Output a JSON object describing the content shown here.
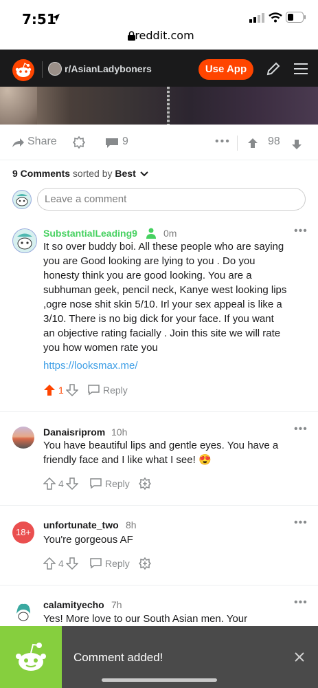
{
  "status_bar": {
    "time": "7:51",
    "url": "reddit.com"
  },
  "nav": {
    "subreddit": "r/AsianLadyboners",
    "use_app_label": "Use App"
  },
  "post_actions": {
    "share_label": "Share",
    "comment_count": "9",
    "score": "98"
  },
  "comments_header": {
    "count_label": "9 Comments",
    "sorted_by": "sorted by",
    "sort_value": "Best"
  },
  "comment_input": {
    "placeholder": "Leave a comment"
  },
  "comments": [
    {
      "username": "SubstantialLeading9",
      "time": "0m",
      "body_lines": [
        "It so over buddy boi. All these people who are saying",
        "you are Good looking are lying to you . Do you",
        "honesty think you are good looking. You are a",
        "subhuman geek, pencil neck, Kanye west looking lips",
        ",ogre nose shit skin 5/10. Irl your sex appeal is like a",
        "3/10. There is no big dick for your face. If you want",
        "an objective rating facially . Join this site we will rate",
        "you how women rate you"
      ],
      "link": "https://looksmax.me/",
      "votes": "1",
      "reply_label": "Reply"
    },
    {
      "username": "Danaisriprom",
      "time": "10h",
      "body_lines": [
        "You have beautiful lips and gentle eyes. You have a",
        "friendly face and I like what I see! 😍"
      ],
      "votes": "4",
      "reply_label": "Reply"
    },
    {
      "username": "unfortunate_two",
      "time": "8h",
      "avatar_text": "18+",
      "body_lines": [
        "You're gorgeous AF"
      ],
      "votes": "4",
      "reply_label": "Reply"
    },
    {
      "username": "calamityecho",
      "time": "7h",
      "body_lines": [
        "Yes! More love to our South Asian men. Your"
      ]
    }
  ],
  "toast": {
    "message": "Comment added!"
  },
  "colors": {
    "brand": "#ff4500",
    "nav_bg": "#1a1a1b",
    "op_name": "#46d160",
    "link": "#3d9ee6",
    "toast_accent": "#86cf3e"
  }
}
